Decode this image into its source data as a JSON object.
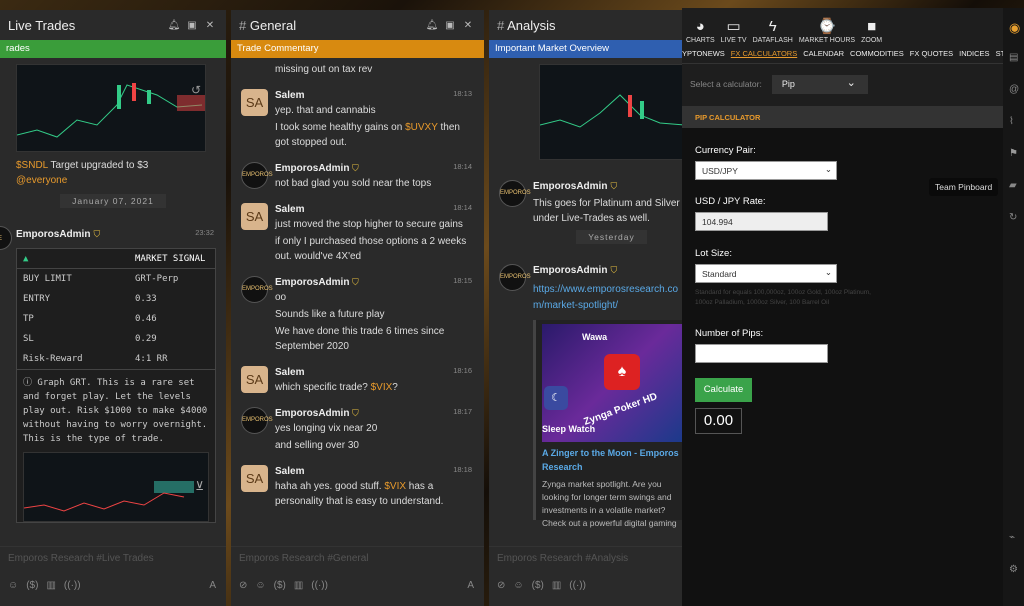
{
  "panels": [
    {
      "title": "Live Trades",
      "subtitle": "rades",
      "input": "Emporos Research #Live Trades"
    },
    {
      "title": "General",
      "subtitle": "Trade Commentary",
      "input": "Emporos Research #General"
    },
    {
      "title": "Analysis",
      "subtitle": "Important Market Overview",
      "input": "Emporos Research #Analysis"
    }
  ],
  "live": {
    "msg1": {
      "tag": "$SNDL",
      "text": " Target upgraded to $3",
      "mention": "@everyone"
    },
    "date": "January 07, 2021",
    "msg2": {
      "user": "EmporosAdmin",
      "time": "23:32"
    },
    "signal": {
      "title": "MARKET SIGNAL",
      "rows": [
        [
          "BUY LIMIT",
          "GRT-Perp"
        ],
        [
          "ENTRY",
          "0.33"
        ],
        [
          "TP",
          "0.46"
        ],
        [
          "SL",
          "0.29"
        ],
        [
          "Risk-Reward",
          "4:1 RR"
        ]
      ],
      "note": "ⓘ Graph GRT. This is a rare set and forget play. Let the levels play out. Risk $1000 to make $4000 without having to worry overnight. This is the type of trade."
    }
  },
  "general": [
    {
      "type": "cont",
      "text": "missing out on tax rev"
    },
    {
      "user": "Salem",
      "time": "18:13",
      "av": "SA",
      "lines": [
        "yep. that and cannabis",
        "I took some healthy gains on |$UVXY| then got stopped out."
      ]
    },
    {
      "user": "EmporosAdmin",
      "time": "18:14",
      "lines": [
        "not bad glad you sold near the tops"
      ]
    },
    {
      "user": "Salem",
      "time": "18:14",
      "av": "SA",
      "lines": [
        "just moved the stop higher to secure gains",
        "if only I purchased those options a 2 weeks out. would've 4X'ed"
      ]
    },
    {
      "user": "EmporosAdmin",
      "time": "18:15",
      "lines": [
        "oo",
        "Sounds like a future play",
        "We have done this trade 6 times since September 2020"
      ]
    },
    {
      "user": "Salem",
      "time": "18:16",
      "av": "SA",
      "lines": [
        "which specific trade? |$VIX|?"
      ]
    },
    {
      "user": "EmporosAdmin",
      "time": "18:17",
      "lines": [
        "yes longing vix near 20",
        "and selling over 30"
      ]
    },
    {
      "user": "Salem",
      "time": "18:18",
      "av": "SA",
      "lines": [
        "haha ah yes. good stuff. |$VIX| has a personality that is easy to understand."
      ]
    }
  ],
  "analysis": {
    "m1": {
      "user": "EmporosAdmin",
      "text": "This goes for Platinum and Silver under Live-Trades as well."
    },
    "date": "Yesterday",
    "m2": {
      "user": "EmporosAdmin",
      "link": "https://www.emporosresearch.com/market-spotlight/",
      "embed_title": "A Zinger to the Moon - Emporos Research",
      "embed_text": "Zynga market spotlight. Are you looking for longer term swings and investments in a volatile market? Check out a powerful digital gaming company.",
      "img_words": [
        "Wawa",
        "Zynga Poker HD",
        "Sleep Watch"
      ]
    }
  },
  "right": {
    "icons": [
      {
        "name": "chart-icon",
        "label": "CHARTS",
        "g": "◕"
      },
      {
        "name": "tv-icon",
        "label": "LIVE TV",
        "g": "▭"
      },
      {
        "name": "bolt-icon",
        "label": "DATAFLASH",
        "g": "ϟ"
      },
      {
        "name": "clock-icon",
        "label": "MARKET HOURS",
        "g": "⌚"
      },
      {
        "name": "video-icon",
        "label": "ZOOM",
        "g": "■"
      }
    ],
    "tabs": [
      "YPTONEWS",
      "FX CALCULATORS",
      "CALENDAR",
      "COMMODITIES",
      "FX QUOTES",
      "INDICES",
      "STOCKS"
    ],
    "active_tab": "FX CALCULATORS",
    "select_label": "Select a calculator:",
    "select_value": "Pip",
    "calc_title": "PIP CALCULATOR",
    "pair_label": "Currency Pair:",
    "pair_value": "USD/JPY",
    "rate_label": "USD / JPY Rate:",
    "rate_value": "104.994",
    "lot_label": "Lot Size:",
    "lot_value": "Standard",
    "lot_hint": "Standard for equals 100,000oz, 100oz Gold, 100oz Platinum, 100oz Palladium, 1000oz Silver, 100 Barrel Oil",
    "pips_label": "Number of Pips:",
    "button": "Calculate",
    "result": "0.00",
    "tooltip": "Team Pinboard"
  }
}
